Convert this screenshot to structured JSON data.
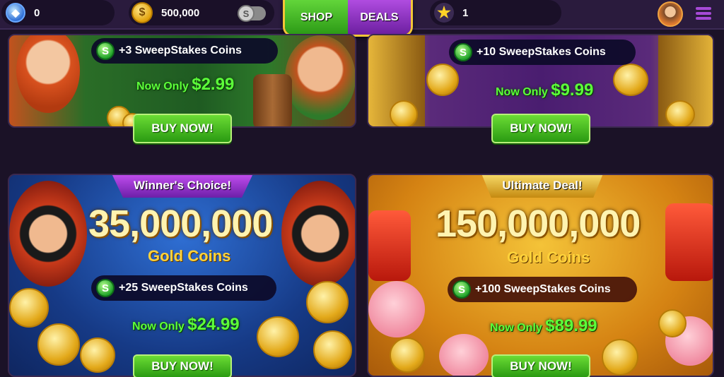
{
  "header": {
    "gems": "0",
    "gold_coins": "500,000",
    "toggle_icon": "S",
    "tabs": [
      {
        "label": "SHOP"
      },
      {
        "label": "DEALS"
      }
    ],
    "stars": "1"
  },
  "colors": {
    "accent_green": "#5dff3a",
    "tab_shop": "#2c9a16",
    "tab_deals": "#6c1fa0",
    "background": "#1b1227"
  },
  "icons": [
    "gem-icon",
    "gold-coin-icon",
    "sweep-toggle-icon",
    "star-icon",
    "avatar",
    "menu-icon",
    "sweep-coin-icon"
  ],
  "offers": [
    {
      "sweep": "+3 SweepStakes Coins",
      "price_label": "Now Only",
      "price": "$2.99",
      "buy_label": "BUY NOW!"
    },
    {
      "sweep": "+10 SweepStakes Coins",
      "price_label": "Now Only",
      "price": "$9.99",
      "buy_label": "BUY NOW!"
    },
    {
      "banner": "Winner's Choice!",
      "coins": "35,000,000",
      "coins_label": "Gold Coins",
      "sweep": "+25 SweepStakes Coins",
      "price_label": "Now Only",
      "price": "$24.99",
      "buy_label": "BUY NOW!"
    },
    {
      "banner": "Ultimate Deal!",
      "coins": "150,000,000",
      "coins_label": "Gold Coins",
      "sweep": "+100 SweepStakes Coins",
      "price_label": "Now Only",
      "price": "$89.99",
      "buy_label": "BUY NOW!"
    }
  ],
  "sweep_icon_letter": "S"
}
